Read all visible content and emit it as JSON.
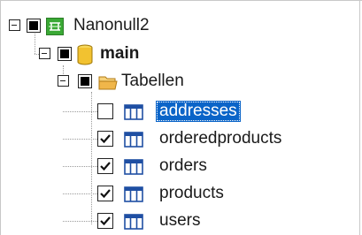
{
  "tree": {
    "root": {
      "label": "Nanonull2",
      "icon": "database-connection-icon",
      "checkbox_state": "indeterminate"
    },
    "schema": {
      "label": "main",
      "icon": "database-cylinder-icon",
      "checkbox_state": "indeterminate"
    },
    "folder": {
      "label": "Tabellen",
      "icon": "folder-icon",
      "checkbox_state": "indeterminate"
    },
    "tables": [
      {
        "label": "addresses",
        "checked": false,
        "selected": true,
        "icon": "table-icon"
      },
      {
        "label": "orderedproducts",
        "checked": true,
        "selected": false,
        "icon": "table-icon"
      },
      {
        "label": "orders",
        "checked": true,
        "selected": false,
        "icon": "table-icon"
      },
      {
        "label": "products",
        "checked": true,
        "selected": false,
        "icon": "table-icon"
      },
      {
        "label": "users",
        "checked": true,
        "selected": false,
        "icon": "table-icon"
      }
    ]
  },
  "colors": {
    "selection": "#0a64c8",
    "connection_icon": "#3aa935",
    "table_icon": "#1f4fa3",
    "cylinder_icon": "#f2c230",
    "folder_icon": "#f0b64a"
  }
}
